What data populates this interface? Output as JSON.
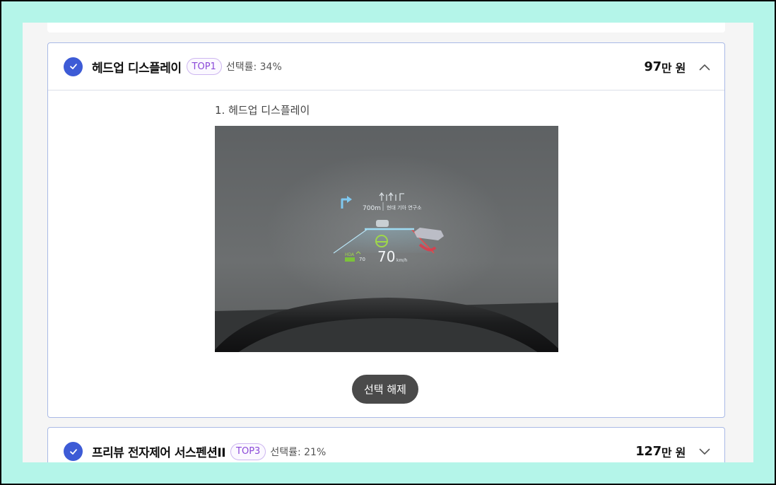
{
  "options": [
    {
      "title": "헤드업 디스플레이",
      "badge": "TOP1",
      "selection_rate": "선택률: 34%",
      "price_number": "97",
      "price_unit": "만 원",
      "expanded": true,
      "detail_label": "1. 헤드업 디스플레이",
      "hud": {
        "distance": "700m",
        "place": "현대 기아 연구소",
        "speed": "70",
        "speed_unit": "km/h",
        "hda": "HDA",
        "set_speed": "70"
      },
      "deselect_label": "선택 해제"
    },
    {
      "title": "프리뷰 전자제어 서스펜션II",
      "badge": "TOP3",
      "selection_rate": "선택률: 21%",
      "price_number": "127",
      "price_unit": "만 원",
      "expanded": false
    }
  ],
  "colors": {
    "page_background": "#b4f5e9",
    "check": "#3d5bd6",
    "card_border": "#a9b9e6",
    "badge": "#8a48d8",
    "deselect_button": "#4a4a4a"
  },
  "icons": {
    "check": "check-circle-icon",
    "collapse": "chevron-up-icon",
    "expand": "chevron-down-icon"
  }
}
